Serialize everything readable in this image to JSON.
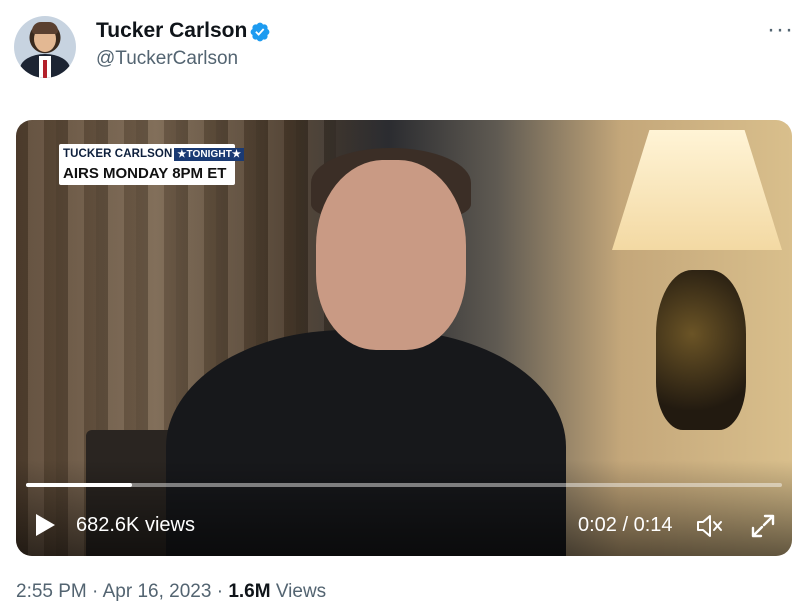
{
  "author": {
    "name": "Tucker Carlson",
    "handle": "@TuckerCarlson",
    "verified_icon": "verified-badge-icon",
    "accent_color": "#1d9bf0"
  },
  "tweet_menu": {
    "icon": "more-options-icon",
    "glyph": "···"
  },
  "video": {
    "chyron": {
      "line1_name": "TUCKER CARLSON",
      "line1_badge": "★TONIGHT★",
      "line2": "AIRS MONDAY 8PM ET"
    },
    "views_label": "682.6K views",
    "time_label": "0:02 / 0:14",
    "progress": 0.14,
    "play_icon": "play-icon",
    "mute_icon": "volume-muted-icon",
    "fullscreen_icon": "fullscreen-icon"
  },
  "meta": {
    "time": "2:55 PM",
    "separator": " · ",
    "date": "Apr 16, 2023",
    "views_count": "1.6M",
    "views_word": " Views"
  }
}
